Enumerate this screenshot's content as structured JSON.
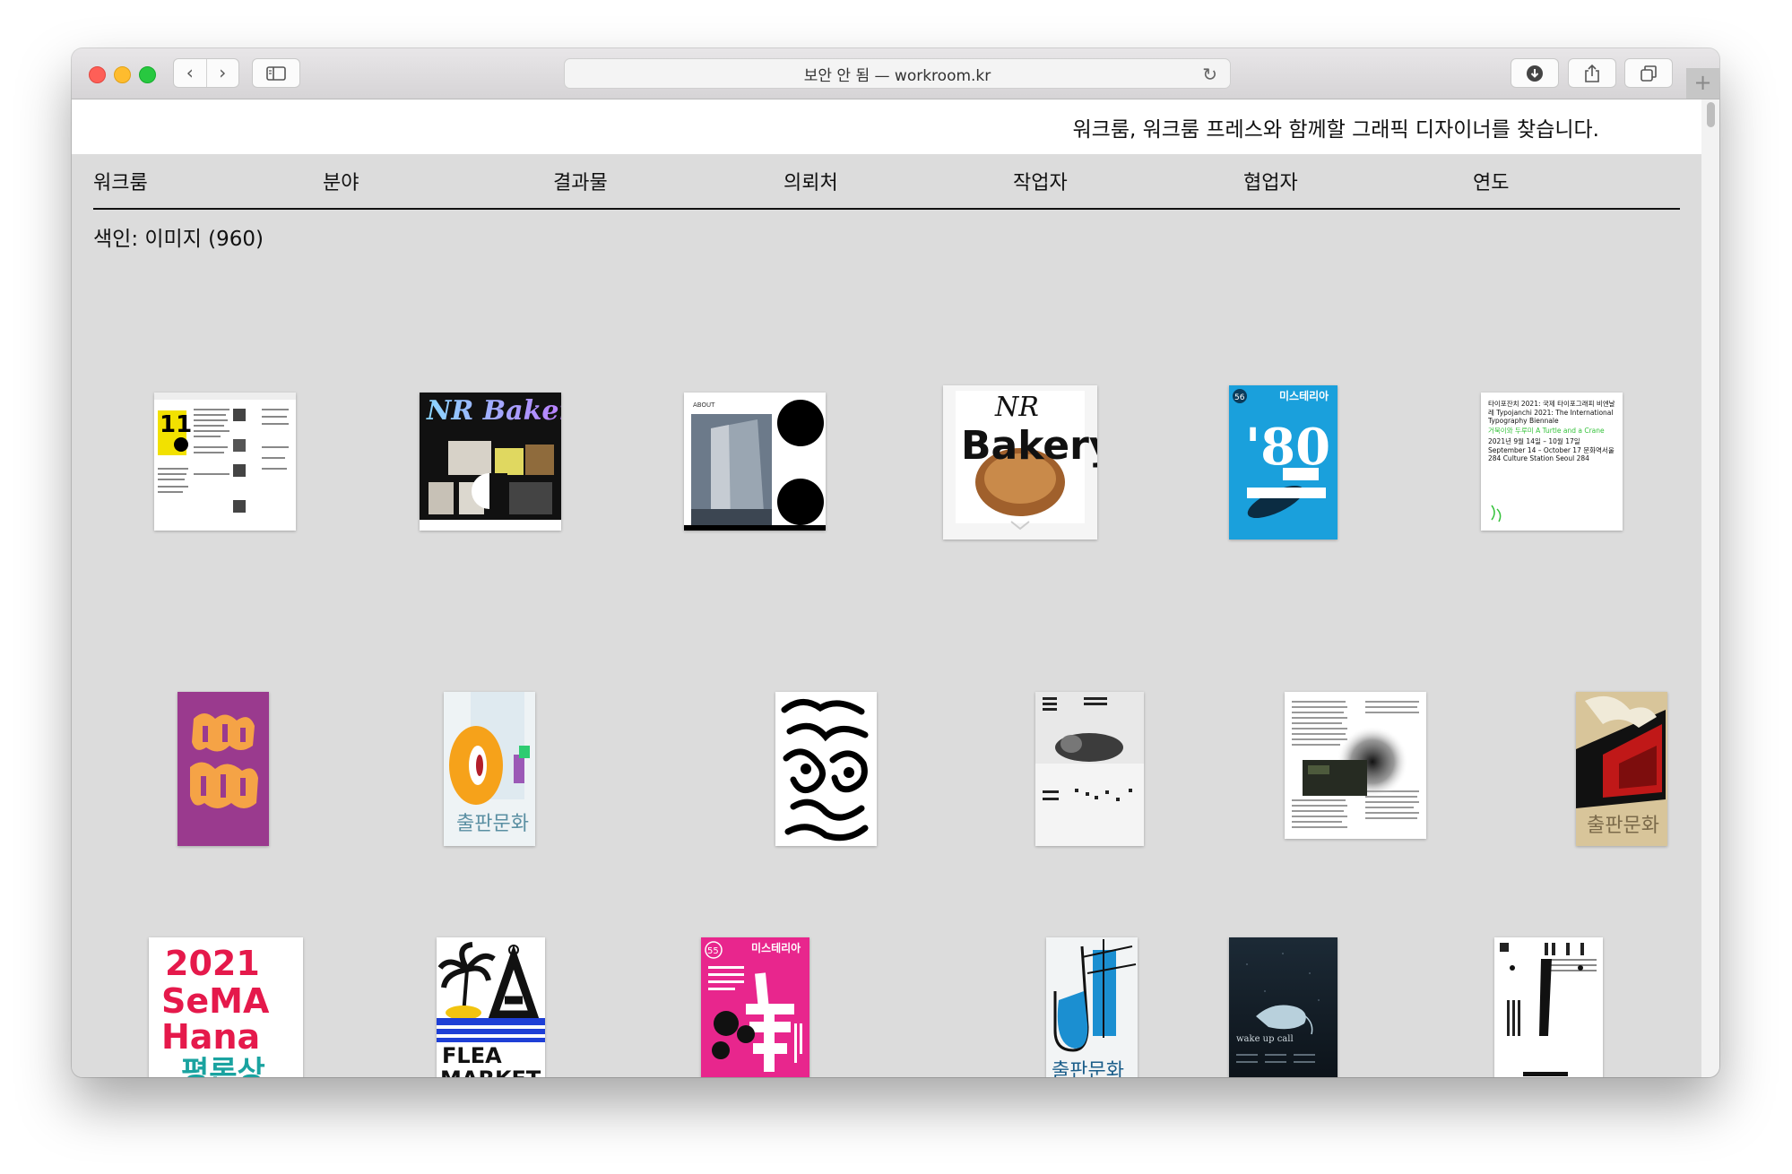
{
  "browser": {
    "address": "보안 안 됨 — workroom.kr",
    "icons": {
      "back": "chevron-left-icon",
      "forward": "chevron-right-icon",
      "sidebar": "sidebar-icon",
      "reload": "reload-icon",
      "download": "download-icon",
      "share": "share-icon",
      "tabs": "tabs-overview-icon",
      "new_tab": "plus-icon"
    }
  },
  "site": {
    "tagline": "워크룸, 워크룸 프레스와 함께할 그래픽 디자이너를 찾습니다.",
    "nav": [
      "워크룸",
      "분야",
      "결과물",
      "의뢰처",
      "작업자",
      "협업자",
      "연도"
    ],
    "index_label": "색인: 이미지 (960)"
  },
  "thumbnails": {
    "t2_logo": "NR Bakery",
    "t4_logo_1": "NR",
    "t4_logo_2": "Bakery",
    "t5_number": "'80",
    "t5_title": "미스테리아",
    "t5_badge": "56",
    "t3_label": "ABOUT",
    "t6_text": "타이포잔치 2021: 국제 타이포그래피 비엔날레 Typojanchi 2021: The International Typography Biennale",
    "t6_accent": "거북이와 두루미 A Turtle and a Crane",
    "t6_dates": "2021년 9월 14일 – 10월 17일 September 14 – October 17 문화역서울 284 Culture Station Seoul 284",
    "t13_text_1": "2021",
    "t13_text_2": "SeMA",
    "t13_text_3": "Hana",
    "t13_text_4": "평론상",
    "t14_text_1": "FLEA",
    "t14_text_2": "MARKET",
    "t15_title": "미스테리아",
    "t15_badge": "55",
    "t17_text": "wake up call",
    "t8_caption": "출판문화",
    "t12_caption": "출판문화",
    "t16_caption": "출판문화",
    "colors": {
      "mysteria_blue": "#1aa0dc",
      "mysteria_pink": "#e8268d",
      "sema_red": "#e5194b",
      "sema_teal": "#1aa3a0",
      "purple": "#9a3a8e",
      "orange": "#f5a346"
    }
  }
}
